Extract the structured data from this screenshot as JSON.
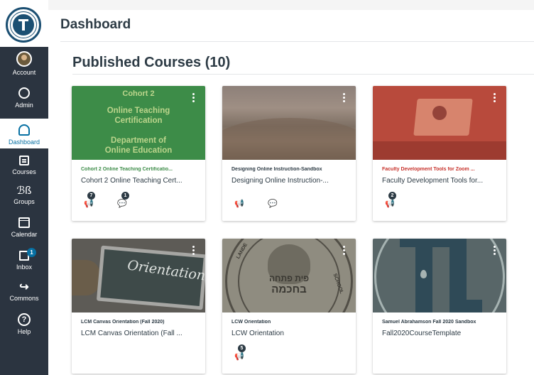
{
  "nav": {
    "account": "Account",
    "admin": "Admin",
    "dashboard": "Dashboard",
    "courses": "Courses",
    "groups": "Groups",
    "calendar": "Calendar",
    "inbox": "Inbox",
    "inbox_badge": "1",
    "commons": "Commons",
    "help": "Help",
    "help_glyph": "?",
    "groups_glyph": "ℬß",
    "commons_glyph": "↪"
  },
  "header": {
    "title": "Dashboard"
  },
  "dashboard": {
    "section_title": "Published Courses (10)",
    "cards": [
      {
        "hero_lines": [
          "Cohort 2",
          "Online Teaching",
          "Certification",
          "Department of",
          "Online Education"
        ],
        "short_name": "Cohort 2 Online Teaching Certificatio...",
        "long_name": "Cohort 2 Online Teaching Cert...",
        "short_color": "#3d8c48",
        "badges": [
          "7",
          "1"
        ]
      },
      {
        "short_name": "Designing Online Instruction-Sandbox",
        "long_name": "Designing Online Instruction-...",
        "short_color": "#2d3b45",
        "badges": []
      },
      {
        "short_name": "Faculty Development Tools for Zoom ...",
        "long_name": "Faculty Development Tools for...",
        "short_color": "#c7322b",
        "badges": [
          "2"
        ]
      },
      {
        "hero_word": "Orientation",
        "short_name": "LCM Canvas Orientation (Fall 2020)",
        "long_name": "LCM Canvas Orientation (Fall ...",
        "short_color": "#2d3b45",
        "badges": []
      },
      {
        "hero_hebrew_1": "פית פתחה",
        "hero_hebrew_2": "בחכמה",
        "hero_arc_left": "LANDE",
        "hero_arc_right": "SCHOOL",
        "short_name": "LCW Orientation",
        "long_name": "LCW Orientation",
        "short_color": "#2d3b45",
        "badges": [
          "5"
        ]
      },
      {
        "short_name": "Samuel Abrahamson Fall 2020 Sandbox",
        "long_name": "Fall2020CourseTemplate",
        "short_color": "#2d3b45",
        "badges": []
      }
    ]
  },
  "icons": {
    "announcement": "📢",
    "discussion": "💬"
  },
  "colors": {
    "nav_bg": "#2b3440",
    "accent": "#0770a3"
  }
}
